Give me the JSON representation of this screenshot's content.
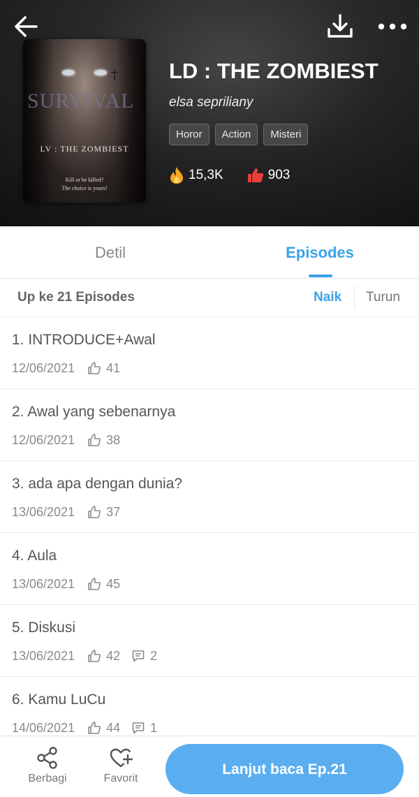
{
  "header": {
    "title": "LD : THE ZOMBIEST",
    "author": "elsa sepriliany",
    "tags": [
      "Horor",
      "Action",
      "Misteri"
    ],
    "views": "15,3K",
    "likes": "903",
    "cover": {
      "title": "SURVIVAL",
      "subtitle": "LV : THE  ZOMBIEST",
      "tagline_1": "Kill or be killed?",
      "tagline_2": "The choice is yours!"
    }
  },
  "tabs": {
    "detail": "Detil",
    "episodes": "Episodes"
  },
  "episode_header": {
    "count": "Up ke 21 Episodes",
    "sort_asc": "Naik",
    "sort_desc": "Turun"
  },
  "episodes": [
    {
      "title": "1. INTRODUCE+Awal",
      "date": "12/06/2021",
      "likes": "41",
      "comments": ""
    },
    {
      "title": "2. Awal yang sebenarnya",
      "date": "12/06/2021",
      "likes": "38",
      "comments": ""
    },
    {
      "title": "3. ada apa dengan dunia?",
      "date": "13/06/2021",
      "likes": "37",
      "comments": ""
    },
    {
      "title": "4. Aula",
      "date": "13/06/2021",
      "likes": "45",
      "comments": ""
    },
    {
      "title": "5. Diskusi",
      "date": "13/06/2021",
      "likes": "42",
      "comments": "2"
    },
    {
      "title": "6. Kamu LuCu",
      "date": "14/06/2021",
      "likes": "44",
      "comments": "1"
    }
  ],
  "bottom_bar": {
    "share": "Berbagi",
    "favorite": "Favorit",
    "continue": "Lanjut baca Ep.21"
  },
  "colors": {
    "accent": "#3aa3e6",
    "button": "#5aaef0",
    "fire": "#f5a623",
    "like_red": "#e8403a",
    "header_bg": "#1e1e1e"
  },
  "icons": [
    "back-arrow-icon",
    "download-icon",
    "more-icon",
    "fire-icon",
    "thumbs-up-icon",
    "like-outline-icon",
    "comment-icon",
    "share-icon",
    "heart-plus-icon"
  ]
}
